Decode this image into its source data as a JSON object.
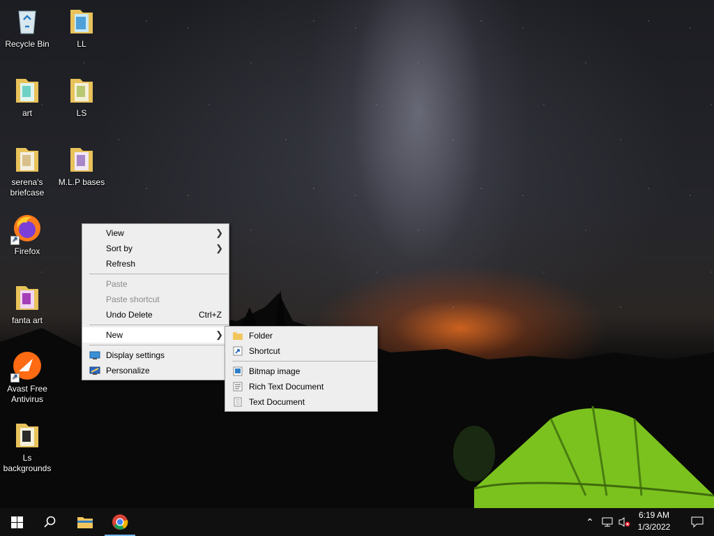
{
  "desktop": {
    "icons": [
      {
        "name": "Recycle Bin",
        "icon": "recycle-bin-icon"
      },
      {
        "name": "LL",
        "icon": "folder-icon"
      },
      {
        "name": "art",
        "icon": "folder-icon"
      },
      {
        "name": "LS",
        "icon": "folder-icon"
      },
      {
        "name": "serena's briefcase",
        "icon": "folder-icon"
      },
      {
        "name": "M.L.P bases",
        "icon": "folder-icon"
      },
      {
        "name": "Firefox",
        "icon": "firefox-icon"
      },
      {
        "name": "fanta art",
        "icon": "folder-icon"
      },
      {
        "name": "Avast Free Antivirus",
        "icon": "avast-icon"
      },
      {
        "name": "Ls backgrounds",
        "icon": "folder-icon"
      }
    ]
  },
  "context_menu": {
    "view": "View",
    "sort_by": "Sort by",
    "refresh": "Refresh",
    "paste": "Paste",
    "paste_shortcut": "Paste shortcut",
    "undo_delete": "Undo Delete",
    "undo_shortcut": "Ctrl+Z",
    "new": "New",
    "display_settings": "Display settings",
    "personalize": "Personalize"
  },
  "new_submenu": {
    "folder": "Folder",
    "shortcut": "Shortcut",
    "bitmap": "Bitmap image",
    "rich_text": "Rich Text Document",
    "text": "Text Document"
  },
  "taskbar": {
    "time": "6:19 AM",
    "date": "1/3/2022",
    "accent": "#76b9ed"
  }
}
